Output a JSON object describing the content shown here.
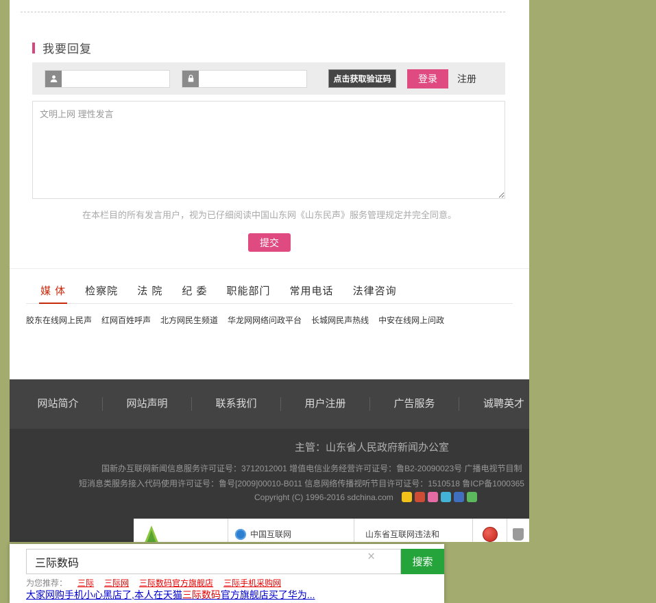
{
  "page": {
    "background_color": "#a3ab6e",
    "accent_pink": "#df4a80",
    "tab_active_red": "#c8290a",
    "search_green": "#25a43b",
    "footer_dark": "#383838"
  },
  "reply": {
    "section_title": "我要回复",
    "captcha_button": "点击获取验证码",
    "login_button": "登录",
    "register_link": "注册",
    "comment_placeholder": "文明上网 理性发言",
    "disclaimer": "在本栏目的所有发言用户，视为已仔细阅读中国山东网《山东民声》服务管理规定并完全同意。",
    "submit_button": "提交"
  },
  "tabs": {
    "items": [
      {
        "label": "媒 体"
      },
      {
        "label": "检察院"
      },
      {
        "label": "法 院"
      },
      {
        "label": "纪 委"
      },
      {
        "label": "职能部门"
      },
      {
        "label": "常用电话"
      },
      {
        "label": "法律咨询"
      }
    ],
    "links": [
      "胶东在线网上民声",
      "红网百姓呼声",
      "北方网民生频道",
      "华龙网网络问政平台",
      "长城网民声热线",
      "中安在线网上问政"
    ]
  },
  "footer": {
    "nav": [
      "网站简介",
      "网站声明",
      "联系我们",
      "用户注册",
      "广告服务",
      "诚聘英才"
    ],
    "supervisor": "主管：山东省人民政府新闻办公室",
    "license_line1": "国新办互联网新闻信息服务许可证号：3712012001 增值电信业务经营许可证号：鲁B2-20090023号 广播电视节目制",
    "license_line2": "短消息类服务接入代码使用许可证号：鲁号[2009]00010-B011 信息网络传播视听节目许可证号：1510518 鲁ICP备1000365",
    "copyright": "Copyright (C) 1996-2016 sdchina.com",
    "share_icons": [
      {
        "name": "share-icon-1",
        "color": "#f2c21b"
      },
      {
        "name": "share-icon-2",
        "color": "#cd4c35"
      },
      {
        "name": "share-icon-3",
        "color": "#e56ba4"
      },
      {
        "name": "share-icon-4",
        "color": "#43b3d8"
      },
      {
        "name": "share-icon-5",
        "color": "#3f6fbe"
      },
      {
        "name": "share-icon-6",
        "color": "#5cb85c"
      }
    ],
    "badge2_text": "中国互联网",
    "badge3_text": "山东省互联网违法和"
  },
  "search_overlay": {
    "query": "三际数码",
    "clear_label": "×",
    "button": "搜索",
    "suggest_label": "为您推荐：",
    "suggestions": [
      "三际",
      "三际网",
      "三际数码官方旗舰店",
      "三际手机采购网"
    ],
    "result_pre": "大家网购手机小心黑店了,本人在天猫",
    "result_highlight": "三际数码",
    "result_post": "官方旗舰店买了华为..."
  }
}
